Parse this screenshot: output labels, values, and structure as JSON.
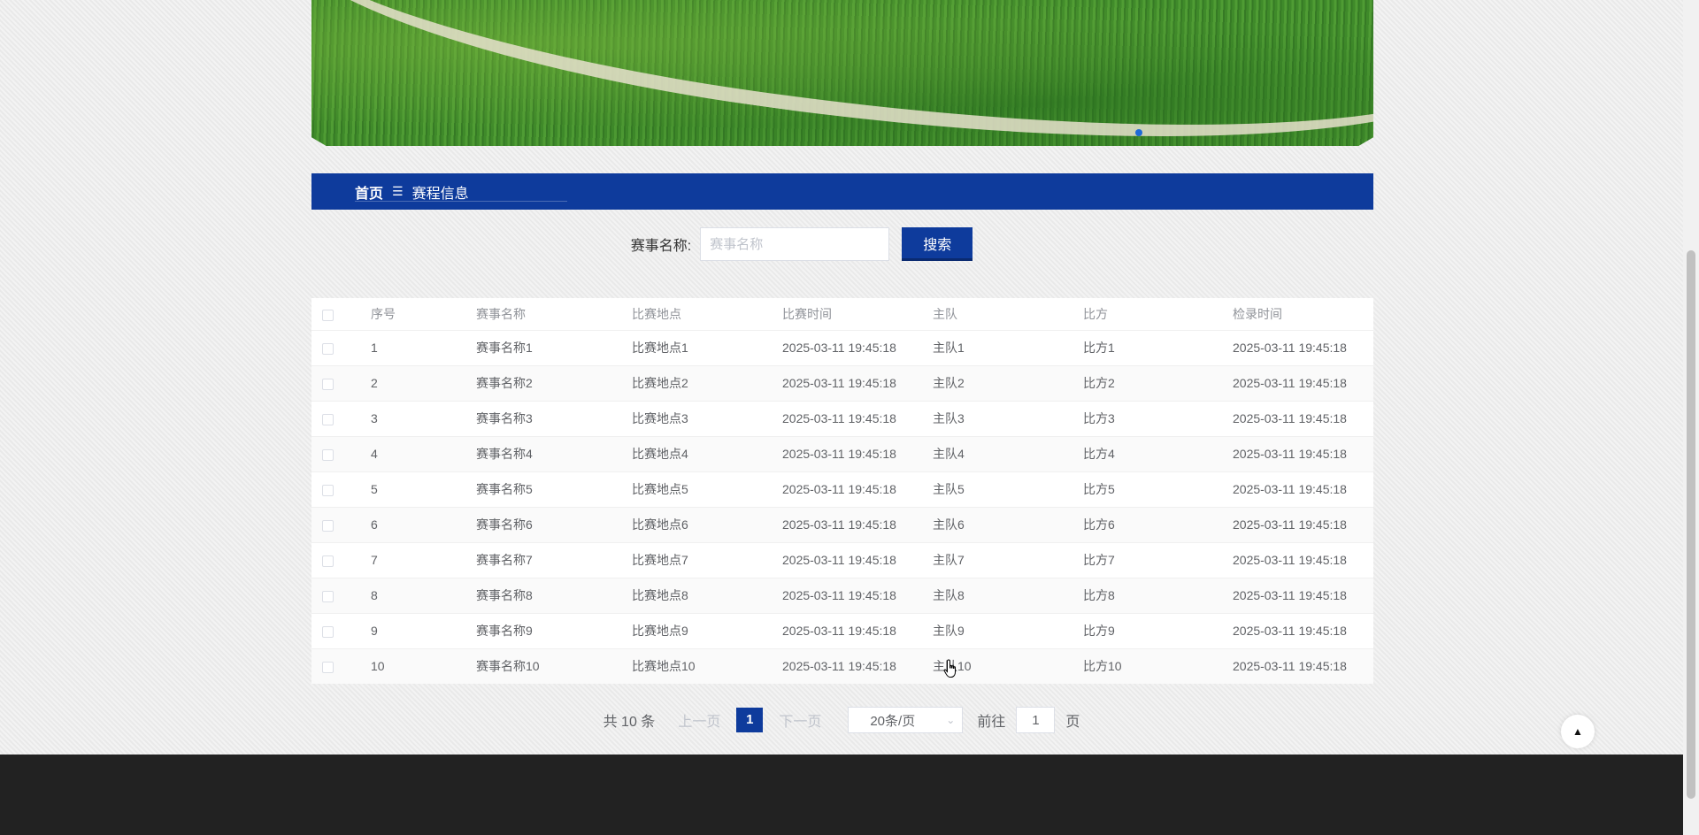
{
  "breadcrumb": {
    "home": "首页",
    "separator": "☰",
    "current": "赛程信息"
  },
  "search": {
    "label": "赛事名称:",
    "placeholder": "赛事名称",
    "button": "搜索"
  },
  "table": {
    "headers": [
      "序号",
      "赛事名称",
      "比赛地点",
      "比赛时间",
      "主队",
      "比方",
      "检录时间"
    ],
    "rows": [
      [
        "1",
        "赛事名称1",
        "比赛地点1",
        "2025-03-11 19:45:18",
        "主队1",
        "比方1",
        "2025-03-11 19:45:18"
      ],
      [
        "2",
        "赛事名称2",
        "比赛地点2",
        "2025-03-11 19:45:18",
        "主队2",
        "比方2",
        "2025-03-11 19:45:18"
      ],
      [
        "3",
        "赛事名称3",
        "比赛地点3",
        "2025-03-11 19:45:18",
        "主队3",
        "比方3",
        "2025-03-11 19:45:18"
      ],
      [
        "4",
        "赛事名称4",
        "比赛地点4",
        "2025-03-11 19:45:18",
        "主队4",
        "比方4",
        "2025-03-11 19:45:18"
      ],
      [
        "5",
        "赛事名称5",
        "比赛地点5",
        "2025-03-11 19:45:18",
        "主队5",
        "比方5",
        "2025-03-11 19:45:18"
      ],
      [
        "6",
        "赛事名称6",
        "比赛地点6",
        "2025-03-11 19:45:18",
        "主队6",
        "比方6",
        "2025-03-11 19:45:18"
      ],
      [
        "7",
        "赛事名称7",
        "比赛地点7",
        "2025-03-11 19:45:18",
        "主队7",
        "比方7",
        "2025-03-11 19:45:18"
      ],
      [
        "8",
        "赛事名称8",
        "比赛地点8",
        "2025-03-11 19:45:18",
        "主队8",
        "比方8",
        "2025-03-11 19:45:18"
      ],
      [
        "9",
        "赛事名称9",
        "比赛地点9",
        "2025-03-11 19:45:18",
        "主队9",
        "比方9",
        "2025-03-11 19:45:18"
      ],
      [
        "10",
        "赛事名称10",
        "比赛地点10",
        "2025-03-11 19:45:18",
        "主队10",
        "比方10",
        "2025-03-11 19:45:18"
      ]
    ]
  },
  "pagination": {
    "total": "共 10 条",
    "prev": "上一页",
    "current_page": "1",
    "next": "下一页",
    "page_size": "20条/页",
    "goto_label": "前往",
    "goto_value": "1",
    "goto_suffix": "页"
  },
  "icons": {
    "back_to_top": "caret-up-icon",
    "size_chevron": "chevron-down-icon"
  },
  "colors": {
    "primary": "#0e3b9c",
    "footer": "#222222"
  }
}
